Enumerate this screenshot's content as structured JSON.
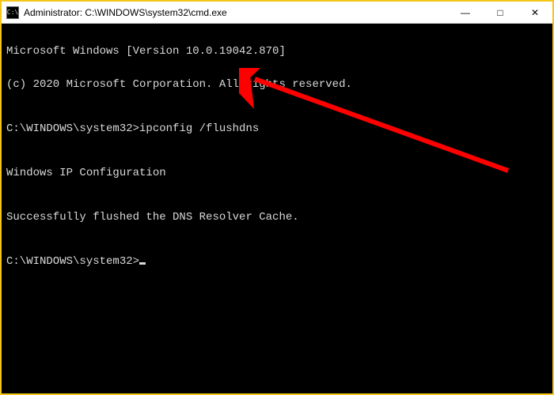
{
  "titlebar": {
    "title": "Administrator: C:\\WINDOWS\\system32\\cmd.exe",
    "icon_label": "C:\\",
    "min_label": "—",
    "max_label": "□",
    "close_label": "✕"
  },
  "terminal": {
    "line1": "Microsoft Windows [Version 10.0.19042.870]",
    "line2": "(c) 2020 Microsoft Corporation. All rights reserved.",
    "prompt1_path": "C:\\WINDOWS\\system32>",
    "prompt1_cmd": "ipconfig /flushdns",
    "line3": "Windows IP Configuration",
    "line4": "Successfully flushed the DNS Resolver Cache.",
    "prompt2_path": "C:\\WINDOWS\\system32>"
  },
  "annotation": {
    "arrow_color": "#ff0000"
  }
}
